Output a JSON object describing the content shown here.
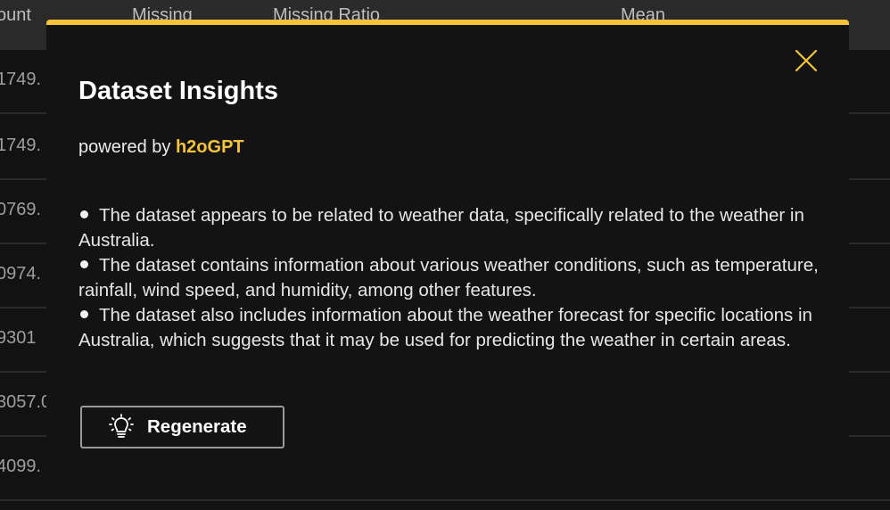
{
  "background_table": {
    "headers": [
      "ount",
      "Missing",
      "Missing Ratio",
      "Mean"
    ],
    "rows": [
      "1749.",
      "1749.",
      "0769.",
      "0974.",
      "9301",
      "3057.0",
      "4099."
    ]
  },
  "modal": {
    "title": "Dataset Insights",
    "powered_prefix": "powered by",
    "powered_brand": "h2oGPT",
    "insights": [
      "The dataset appears to be related to weather data, specifically related to the weather in Australia.",
      "The dataset contains information about various weather conditions, such as temperature, rainfall, wind speed, and humidity, among other features.",
      "The dataset also includes information about the weather forecast for specific locations in Australia, which suggests that it may be used for predicting the weather in certain areas."
    ],
    "regenerate_label": "Regenerate",
    "close_icon": "close-icon",
    "regenerate_icon": "lightbulb-icon"
  },
  "colors": {
    "accent": "#f5c338",
    "modal_bg": "#131313",
    "text": "#e6e6e6"
  }
}
